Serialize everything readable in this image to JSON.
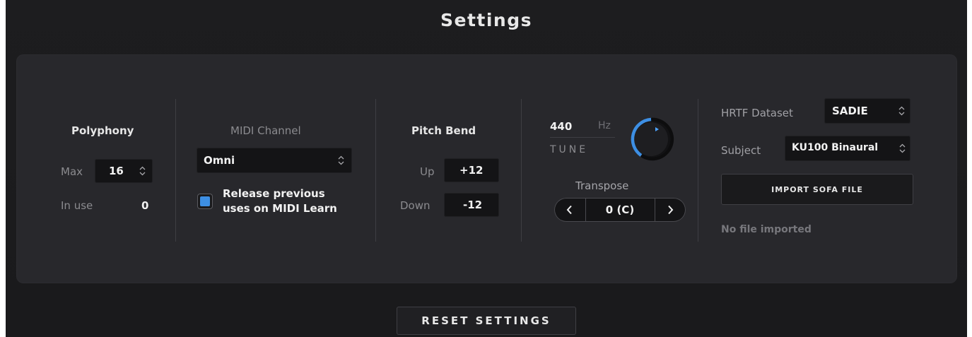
{
  "title": "Settings",
  "polyphony": {
    "heading": "Polyphony",
    "max_label": "Max",
    "max_value": "16",
    "in_use_label": "In use",
    "in_use_value": "0"
  },
  "midi_channel": {
    "heading": "MIDI Channel",
    "selected": "Omni",
    "release_checkbox_line1": "Release previous",
    "release_checkbox_line2": "uses on MIDI Learn",
    "release_checked": true
  },
  "pitch_bend": {
    "heading": "Pitch Bend",
    "up_label": "Up",
    "up_value": "+12",
    "down_label": "Down",
    "down_value": "-12"
  },
  "tune": {
    "value": "440",
    "unit": "Hz",
    "label": "TUNE",
    "knob_icon": "tune-knob",
    "transpose_label": "Transpose",
    "transpose_value": "0 (C)",
    "prev_icon": "chevron-left-icon",
    "next_icon": "chevron-right-icon"
  },
  "hrtf": {
    "dataset_label": "HRTF Dataset",
    "dataset_value": "SADIE",
    "subject_label": "Subject",
    "subject_value": "KU100 Binaural",
    "import_button": "IMPORT SOFA FILE",
    "status": "No file imported"
  },
  "reset_button": "RESET SETTINGS",
  "colors": {
    "accent": "#3d8fe4",
    "background": "#1d1d1f",
    "panel": "#28282c"
  }
}
